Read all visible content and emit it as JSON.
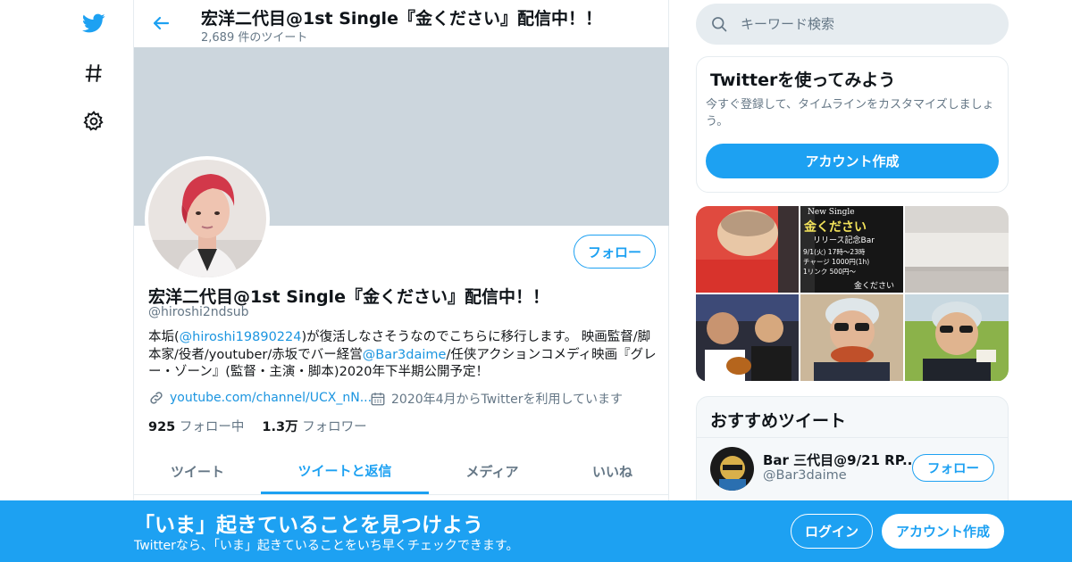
{
  "header": {
    "title": "宏洋二代目@1st Single『金ください』配信中！！",
    "tweet_count": "2,689 件のツイート"
  },
  "profile": {
    "name": "宏洋二代目@1st Single『金ください』配信中！！",
    "handle": "@hiroshi2ndsub",
    "follow_label": "フォロー",
    "bio": {
      "p1": "本垢(",
      "m1": "@hiroshi19890224",
      "p2": ")が復活しなさそうなのでこちらに移行します。 映画監督/脚本家/役者/youtuber/赤坂でバー経営",
      "m2": "@Bar3daime",
      "p3": "/任侠アクションコメディ映画『グレー・ゾーン』(監督・主演・脚本)2020年下半期公開予定！"
    },
    "website": "youtube.com/channel/UCX_nN...",
    "joined": "2020年4月からTwitterを利用しています",
    "following_count": "925",
    "following_label": "フォロー中",
    "followers_count": "1.3万",
    "followers_label": "フォロワー"
  },
  "tabs": [
    {
      "label": "ツイート",
      "active": false
    },
    {
      "label": "ツイートと返信",
      "active": true
    },
    {
      "label": "メディア",
      "active": false
    },
    {
      "label": "いいね",
      "active": false
    }
  ],
  "search": {
    "placeholder": "キーワード検索"
  },
  "signup_card": {
    "title": "Twitterを使ってみよう",
    "desc": "今すぐ登録して、タイムラインをカスタマイズしましょう。",
    "button": "アカウント作成"
  },
  "media_poster": {
    "line1": "New Single",
    "line2": "金ください",
    "line3": "リリース記念Bar",
    "line4": "9/1(火) 17時〜23時",
    "line5": "チャージ 1000円(1h)",
    "line6": "1リンク 500円〜",
    "line7": "金ください"
  },
  "recommended": {
    "title": "おすすめツイート",
    "account_name": "Bar 三代目@9/21 RP...",
    "account_handle": "@Bar3daime",
    "follow_label": "フォロー"
  },
  "bottom_bar": {
    "title": "「いま」起きていることを見つけよう",
    "subtitle": "Twitterなら、「いま」起きていることをいち早くチェックできます。",
    "login": "ログイン",
    "signup": "アカウント作成"
  },
  "colors": {
    "accent": "#1da1f2",
    "banner": "#ccd6dd",
    "secondary_text": "#657786"
  },
  "icons": [
    "twitter-logo-icon",
    "hashtag-icon",
    "gear-icon",
    "back-arrow-icon",
    "search-icon",
    "link-icon",
    "calendar-icon"
  ]
}
